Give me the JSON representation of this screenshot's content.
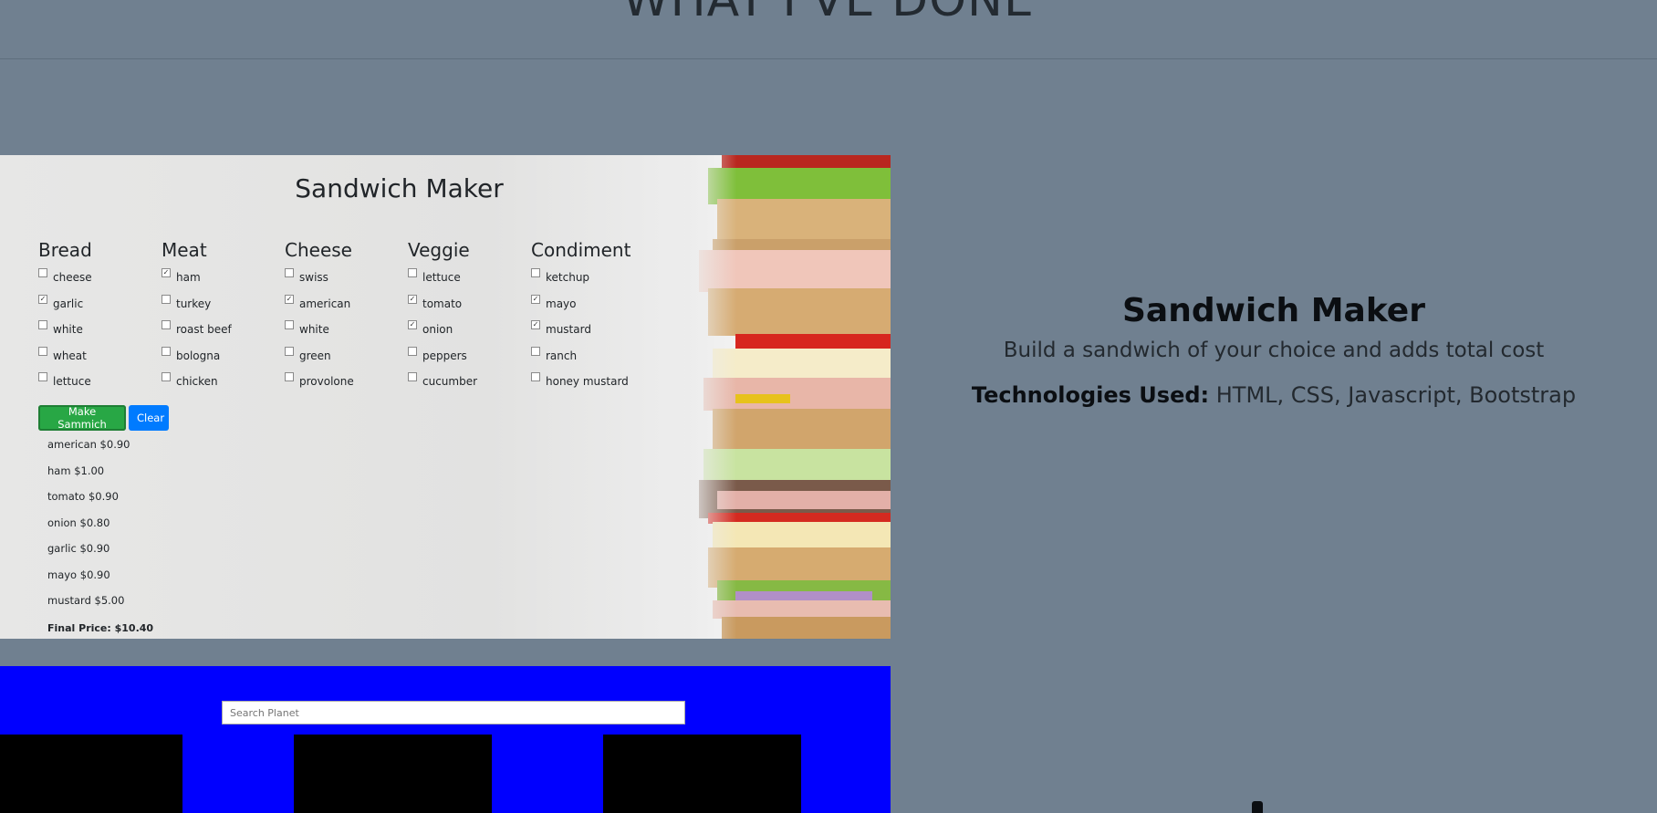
{
  "header": {
    "title": "WHAT I'VE DONE"
  },
  "sandwich_demo": {
    "title": "Sandwich Maker",
    "columns": [
      {
        "heading": "Bread",
        "options": [
          {
            "label": "cheese",
            "checked": false
          },
          {
            "label": "garlic",
            "checked": true
          },
          {
            "label": "white",
            "checked": false
          },
          {
            "label": "wheat",
            "checked": false
          },
          {
            "label": "lettuce",
            "checked": false
          }
        ]
      },
      {
        "heading": "Meat",
        "options": [
          {
            "label": "ham",
            "checked": true
          },
          {
            "label": "turkey",
            "checked": false
          },
          {
            "label": "roast beef",
            "checked": false
          },
          {
            "label": "bologna",
            "checked": false
          },
          {
            "label": "chicken",
            "checked": false
          }
        ]
      },
      {
        "heading": "Cheese",
        "options": [
          {
            "label": "swiss",
            "checked": false
          },
          {
            "label": "american",
            "checked": true
          },
          {
            "label": "white",
            "checked": false
          },
          {
            "label": "green",
            "checked": false
          },
          {
            "label": "provolone",
            "checked": false
          }
        ]
      },
      {
        "heading": "Veggie",
        "options": [
          {
            "label": "lettuce",
            "checked": false
          },
          {
            "label": "tomato",
            "checked": true
          },
          {
            "label": "onion",
            "checked": true
          },
          {
            "label": "peppers",
            "checked": false
          },
          {
            "label": "cucumber",
            "checked": false
          }
        ]
      },
      {
        "heading": "Condiment",
        "options": [
          {
            "label": "ketchup",
            "checked": false
          },
          {
            "label": "mayo",
            "checked": true
          },
          {
            "label": "mustard",
            "checked": true
          },
          {
            "label": "ranch",
            "checked": false
          },
          {
            "label": "honey mustard",
            "checked": false
          }
        ]
      }
    ],
    "make_button": "Make Sammich",
    "clear_button": "Clear",
    "selected_items": [
      "american $0.90",
      "ham $1.00",
      "tomato $0.90",
      "onion $0.80",
      "garlic $0.90",
      "mayo $0.90",
      "mustard $5.00"
    ],
    "final_price": "Final Price: $10.40"
  },
  "project": {
    "title": "Sandwich Maker",
    "description": "Build a sandwich of your choice and adds total cost",
    "tech_label": "Technologies Used:",
    "tech_list": " HTML, CSS, Javascript, Bootstrap"
  },
  "planet_demo": {
    "search_placeholder": "Search Planet"
  },
  "colors": {
    "page_bg": "#708090",
    "planet_bg": "#0000ff",
    "make_button": "#28a745",
    "clear_button": "#007bff"
  }
}
